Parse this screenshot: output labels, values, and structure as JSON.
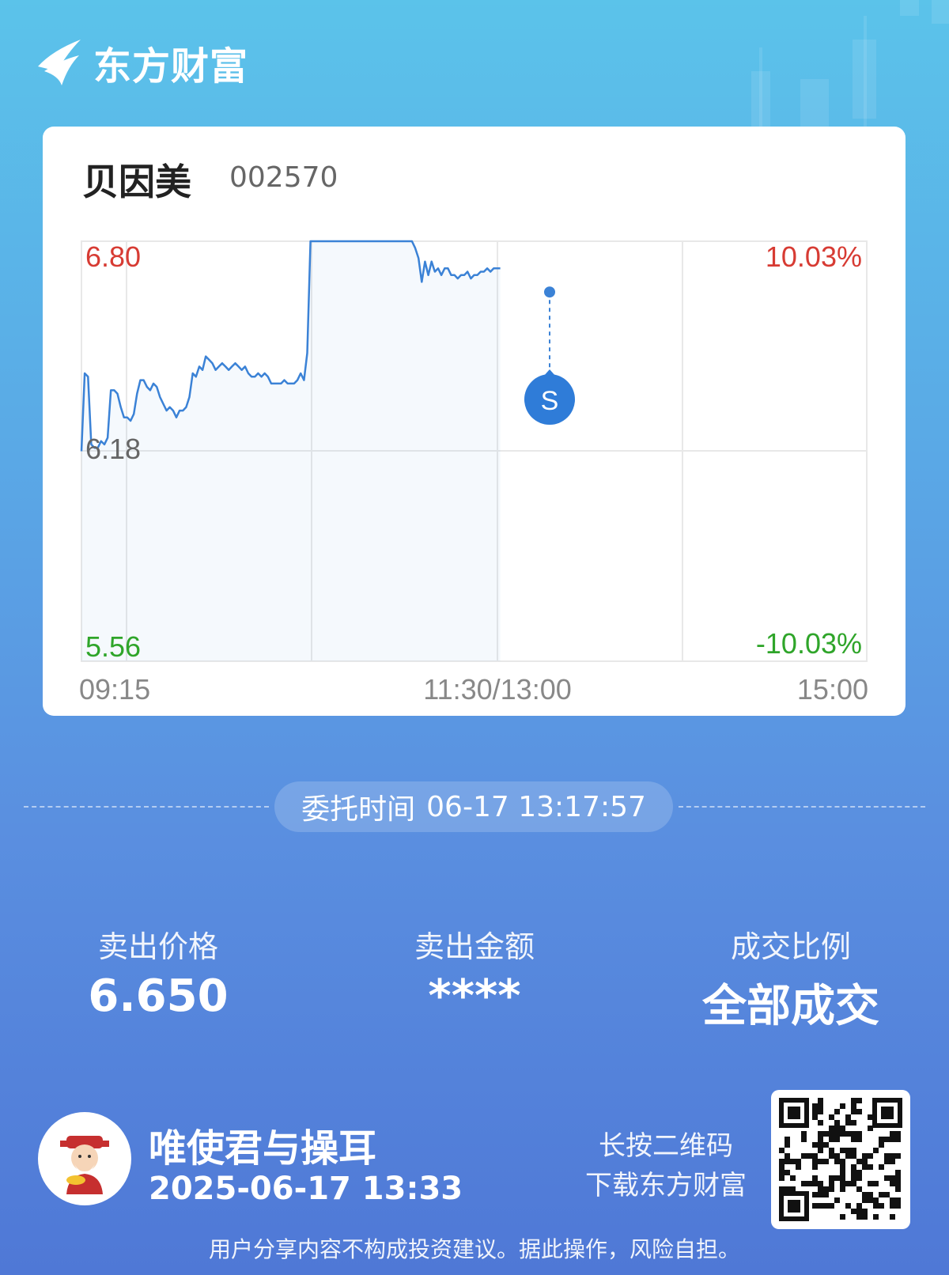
{
  "brand": {
    "name": "东方财富",
    "accent": "#1e6fd0"
  },
  "stock": {
    "name": "贝因美",
    "code": "002570"
  },
  "chart_data": {
    "type": "line",
    "y_left_labels": {
      "top": "6.80",
      "mid": "6.18",
      "bottom": "5.56"
    },
    "y_right_labels": {
      "top": "10.03%",
      "bottom": "-10.03%"
    },
    "x_labels": [
      "09:15",
      "11:30/13:00",
      "15:00"
    ],
    "ylim": [
      5.56,
      6.8
    ],
    "pre_close": 6.18,
    "marker": {
      "label": "S",
      "time": "13:17",
      "price": 6.65
    },
    "prices": [
      6.18,
      6.41,
      6.4,
      6.2,
      6.19,
      6.19,
      6.21,
      6.2,
      6.22,
      6.36,
      6.36,
      6.35,
      6.31,
      6.28,
      6.28,
      6.27,
      6.29,
      6.35,
      6.39,
      6.39,
      6.37,
      6.36,
      6.38,
      6.37,
      6.34,
      6.32,
      6.3,
      6.31,
      6.3,
      6.28,
      6.3,
      6.3,
      6.31,
      6.34,
      6.41,
      6.4,
      6.43,
      6.42,
      6.46,
      6.45,
      6.44,
      6.42,
      6.43,
      6.44,
      6.43,
      6.42,
      6.43,
      6.44,
      6.43,
      6.42,
      6.43,
      6.41,
      6.4,
      6.4,
      6.41,
      6.4,
      6.41,
      6.4,
      6.38,
      6.38,
      6.38,
      6.38,
      6.39,
      6.38,
      6.38,
      6.38,
      6.39,
      6.41,
      6.39,
      6.47,
      6.8,
      6.8,
      6.8,
      6.8,
      6.8,
      6.8,
      6.8,
      6.8,
      6.8,
      6.8,
      6.8,
      6.8,
      6.8,
      6.8,
      6.8,
      6.8,
      6.8,
      6.8,
      6.8,
      6.8,
      6.8,
      6.8,
      6.8,
      6.8,
      6.8,
      6.8,
      6.8,
      6.8,
      6.8,
      6.8,
      6.8,
      6.8,
      6.78,
      6.75,
      6.68,
      6.74,
      6.7,
      6.74,
      6.71,
      6.72,
      6.7,
      6.72,
      6.72,
      6.7,
      6.7,
      6.69,
      6.7,
      6.7,
      6.71,
      6.69,
      6.7,
      6.7,
      6.71,
      6.71,
      6.72,
      6.71,
      6.72,
      6.72,
      6.72
    ]
  },
  "order_time": {
    "label": "委托时间",
    "value": "06-17 13:17:57"
  },
  "stats": [
    {
      "label": "卖出价格",
      "value": "6.650"
    },
    {
      "label": "卖出金额",
      "value": "****"
    },
    {
      "label": "成交比例",
      "value": "全部成交"
    }
  ],
  "user": {
    "name": "唯使君与操耳",
    "time": "2025-06-17 13:33"
  },
  "qr_hint": {
    "line1": "长按二维码",
    "line2": "下载东方财富"
  },
  "disclaimer": "用户分享内容不构成投资建议。据此操作，风险自担。",
  "colors": {
    "up": "#d73b33",
    "down": "#2fa52a",
    "line": "#3b82d6"
  }
}
